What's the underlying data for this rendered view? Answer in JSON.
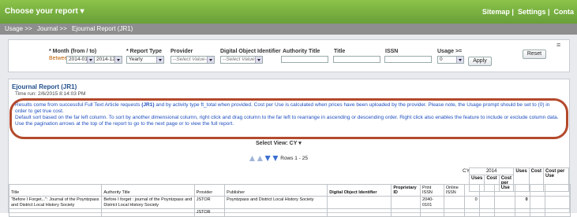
{
  "topbar": {
    "report_menu": "Choose your report",
    "links": [
      "Sitemap",
      "Settings",
      "Conta"
    ]
  },
  "breadcrumb": [
    "Usage >>",
    "Journal >>",
    "Ejournal Report (JR1)"
  ],
  "filters": {
    "month_label": "* Month (from / to)",
    "between_label": "Between",
    "month_from": "2014-01",
    "month_to": "2014-12",
    "report_type_label": "* Report Type",
    "report_type_value": "Yearly",
    "provider_label": "Provider",
    "provider_placeholder": "--Select Value--",
    "doi_label": "Digital Object Identifier",
    "doi_placeholder": "--Select Value--",
    "authority_title_label": "Authority Title",
    "title_label": "Title",
    "issn_label": "ISSN",
    "usage_label": "Usage >=",
    "usage_value": "0",
    "apply_label": "Apply",
    "reset_label": "Reset"
  },
  "report": {
    "title": "Ejournal Report (JR1)",
    "time_run": "Time run: 2/6/2015 8:14:03 PM",
    "info_line1a": "Results come from successful Full Text Article requests ",
    "info_bold": "(JR1)",
    "info_line1b": " and by activity type ft_total when provided. Cost per Use is calculated when prices have been uploaded by the provider. Please note, the Usage prompt should be set to (0) in order to get true cost.",
    "info_line2": "Default sort based on the far left column. To sort by another dimensional column, right click and drag column to the far left to rearrange in ascending or descending order. Right click also enables the feature to include or exclude column data.",
    "info_line3": "Use the pagination arrows at the top of the report to go to the next page or to view the full report.",
    "select_view": "Select View:  CY",
    "rows": "Rows 1 - 25"
  },
  "table": {
    "cy_label": "CY",
    "year": "2014",
    "top_headers": [
      "Uses",
      "Cost",
      "Cost per Use"
    ],
    "sub_headers": [
      "Uses",
      "Cost",
      "Cost per Use"
    ],
    "columns": [
      "Title",
      "Authority Title",
      "Provider",
      "Publisher",
      "Digital Object Identifier",
      "Proprietary ID",
      "Print ISSN",
      "Online ISSN"
    ],
    "rows": [
      {
        "title": "\"Before I Forget...\": Journal of the Poyntzpass and District Local History Society",
        "authority_title": "Before I forget : journal of the Poyntzpass and District Local History Society",
        "provider": "JSTOR",
        "publisher": "Poyntzpass and District Local History Society",
        "doi": "",
        "proprietary_id": "",
        "print_issn": "2040-0101",
        "online_issn": "",
        "uses": "0",
        "total_uses": "0"
      },
      {
        "title": "",
        "authority_title": "",
        "provider": "JSTOR",
        "publisher": "",
        "doi": "",
        "proprietary_id": "",
        "print_issn": "",
        "online_issn": "",
        "uses": "",
        "total_uses": ""
      }
    ]
  }
}
